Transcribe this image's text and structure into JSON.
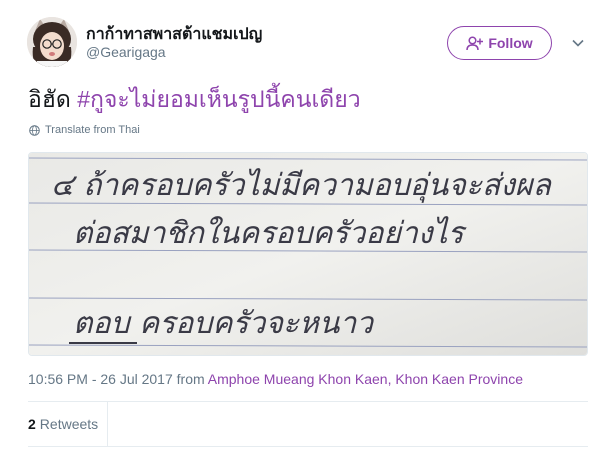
{
  "user": {
    "display_name": "กาก้าทาสพาสต้าแชมเปญ",
    "handle": "@Gearigaga",
    "avatar_icon": "profile-photo"
  },
  "follow_button": {
    "label": "Follow",
    "icon": "add-person-icon",
    "color": "#8e44ad"
  },
  "menu_icon": "chevron-down-icon",
  "tweet": {
    "text_prefix": "อิฮัด ",
    "hashtag": "#กูจะไม่ยอมเห็นรูปนี้คนเดียว",
    "hashtag_color": "#8e44ad"
  },
  "translate": {
    "label": "Translate from Thai",
    "icon": "globe-icon"
  },
  "photo": {
    "lines": [
      "๔ ถ้าครอบครัวไม่มีความอบอุ่นจะส่งผล",
      "ต่อสมาชิกในครอบครัวอย่างไร",
      "ตอบ ครอบครัวจะหนาว"
    ]
  },
  "meta": {
    "time": "10:56 PM - 26 Jul 2017 from ",
    "location": "Amphoe Mueang Khon Kaen, Khon Kaen Province"
  },
  "stats": {
    "retweets_count": "2",
    "retweets_label": "Retweets"
  }
}
